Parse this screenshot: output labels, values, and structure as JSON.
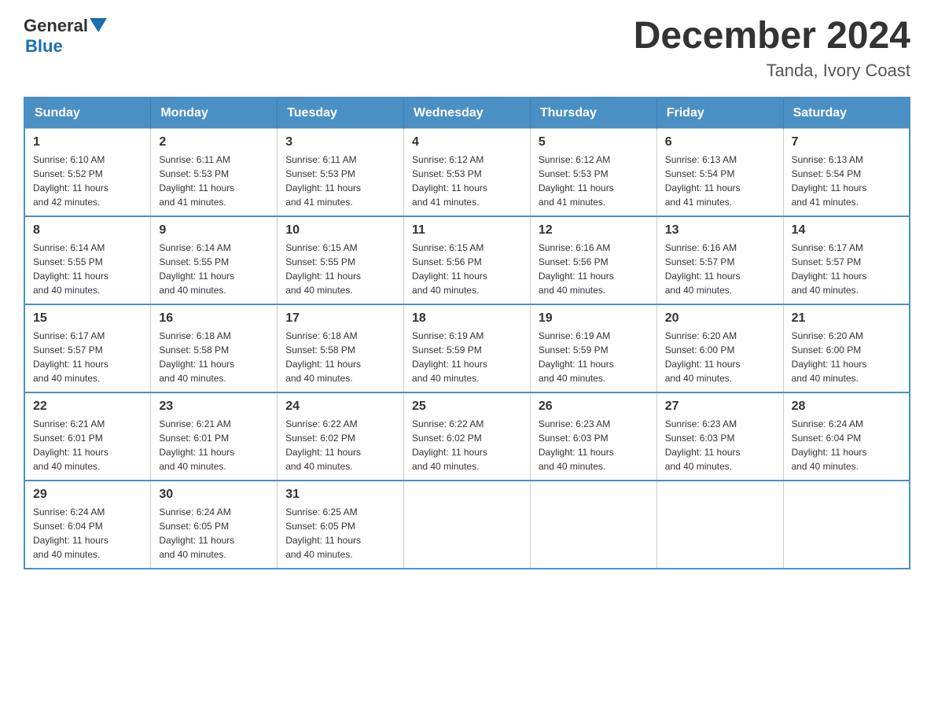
{
  "logo": {
    "general": "General",
    "blue": "Blue"
  },
  "title": {
    "month": "December 2024",
    "location": "Tanda, Ivory Coast"
  },
  "weekdays": [
    "Sunday",
    "Monday",
    "Tuesday",
    "Wednesday",
    "Thursday",
    "Friday",
    "Saturday"
  ],
  "weeks": [
    [
      {
        "day": "1",
        "sunrise": "6:10 AM",
        "sunset": "5:52 PM",
        "daylight": "11 hours and 42 minutes."
      },
      {
        "day": "2",
        "sunrise": "6:11 AM",
        "sunset": "5:53 PM",
        "daylight": "11 hours and 41 minutes."
      },
      {
        "day": "3",
        "sunrise": "6:11 AM",
        "sunset": "5:53 PM",
        "daylight": "11 hours and 41 minutes."
      },
      {
        "day": "4",
        "sunrise": "6:12 AM",
        "sunset": "5:53 PM",
        "daylight": "11 hours and 41 minutes."
      },
      {
        "day": "5",
        "sunrise": "6:12 AM",
        "sunset": "5:53 PM",
        "daylight": "11 hours and 41 minutes."
      },
      {
        "day": "6",
        "sunrise": "6:13 AM",
        "sunset": "5:54 PM",
        "daylight": "11 hours and 41 minutes."
      },
      {
        "day": "7",
        "sunrise": "6:13 AM",
        "sunset": "5:54 PM",
        "daylight": "11 hours and 41 minutes."
      }
    ],
    [
      {
        "day": "8",
        "sunrise": "6:14 AM",
        "sunset": "5:55 PM",
        "daylight": "11 hours and 40 minutes."
      },
      {
        "day": "9",
        "sunrise": "6:14 AM",
        "sunset": "5:55 PM",
        "daylight": "11 hours and 40 minutes."
      },
      {
        "day": "10",
        "sunrise": "6:15 AM",
        "sunset": "5:55 PM",
        "daylight": "11 hours and 40 minutes."
      },
      {
        "day": "11",
        "sunrise": "6:15 AM",
        "sunset": "5:56 PM",
        "daylight": "11 hours and 40 minutes."
      },
      {
        "day": "12",
        "sunrise": "6:16 AM",
        "sunset": "5:56 PM",
        "daylight": "11 hours and 40 minutes."
      },
      {
        "day": "13",
        "sunrise": "6:16 AM",
        "sunset": "5:57 PM",
        "daylight": "11 hours and 40 minutes."
      },
      {
        "day": "14",
        "sunrise": "6:17 AM",
        "sunset": "5:57 PM",
        "daylight": "11 hours and 40 minutes."
      }
    ],
    [
      {
        "day": "15",
        "sunrise": "6:17 AM",
        "sunset": "5:57 PM",
        "daylight": "11 hours and 40 minutes."
      },
      {
        "day": "16",
        "sunrise": "6:18 AM",
        "sunset": "5:58 PM",
        "daylight": "11 hours and 40 minutes."
      },
      {
        "day": "17",
        "sunrise": "6:18 AM",
        "sunset": "5:58 PM",
        "daylight": "11 hours and 40 minutes."
      },
      {
        "day": "18",
        "sunrise": "6:19 AM",
        "sunset": "5:59 PM",
        "daylight": "11 hours and 40 minutes."
      },
      {
        "day": "19",
        "sunrise": "6:19 AM",
        "sunset": "5:59 PM",
        "daylight": "11 hours and 40 minutes."
      },
      {
        "day": "20",
        "sunrise": "6:20 AM",
        "sunset": "6:00 PM",
        "daylight": "11 hours and 40 minutes."
      },
      {
        "day": "21",
        "sunrise": "6:20 AM",
        "sunset": "6:00 PM",
        "daylight": "11 hours and 40 minutes."
      }
    ],
    [
      {
        "day": "22",
        "sunrise": "6:21 AM",
        "sunset": "6:01 PM",
        "daylight": "11 hours and 40 minutes."
      },
      {
        "day": "23",
        "sunrise": "6:21 AM",
        "sunset": "6:01 PM",
        "daylight": "11 hours and 40 minutes."
      },
      {
        "day": "24",
        "sunrise": "6:22 AM",
        "sunset": "6:02 PM",
        "daylight": "11 hours and 40 minutes."
      },
      {
        "day": "25",
        "sunrise": "6:22 AM",
        "sunset": "6:02 PM",
        "daylight": "11 hours and 40 minutes."
      },
      {
        "day": "26",
        "sunrise": "6:23 AM",
        "sunset": "6:03 PM",
        "daylight": "11 hours and 40 minutes."
      },
      {
        "day": "27",
        "sunrise": "6:23 AM",
        "sunset": "6:03 PM",
        "daylight": "11 hours and 40 minutes."
      },
      {
        "day": "28",
        "sunrise": "6:24 AM",
        "sunset": "6:04 PM",
        "daylight": "11 hours and 40 minutes."
      }
    ],
    [
      {
        "day": "29",
        "sunrise": "6:24 AM",
        "sunset": "6:04 PM",
        "daylight": "11 hours and 40 minutes."
      },
      {
        "day": "30",
        "sunrise": "6:24 AM",
        "sunset": "6:05 PM",
        "daylight": "11 hours and 40 minutes."
      },
      {
        "day": "31",
        "sunrise": "6:25 AM",
        "sunset": "6:05 PM",
        "daylight": "11 hours and 40 minutes."
      },
      null,
      null,
      null,
      null
    ]
  ],
  "labels": {
    "sunrise": "Sunrise:",
    "sunset": "Sunset:",
    "daylight": "Daylight:"
  }
}
